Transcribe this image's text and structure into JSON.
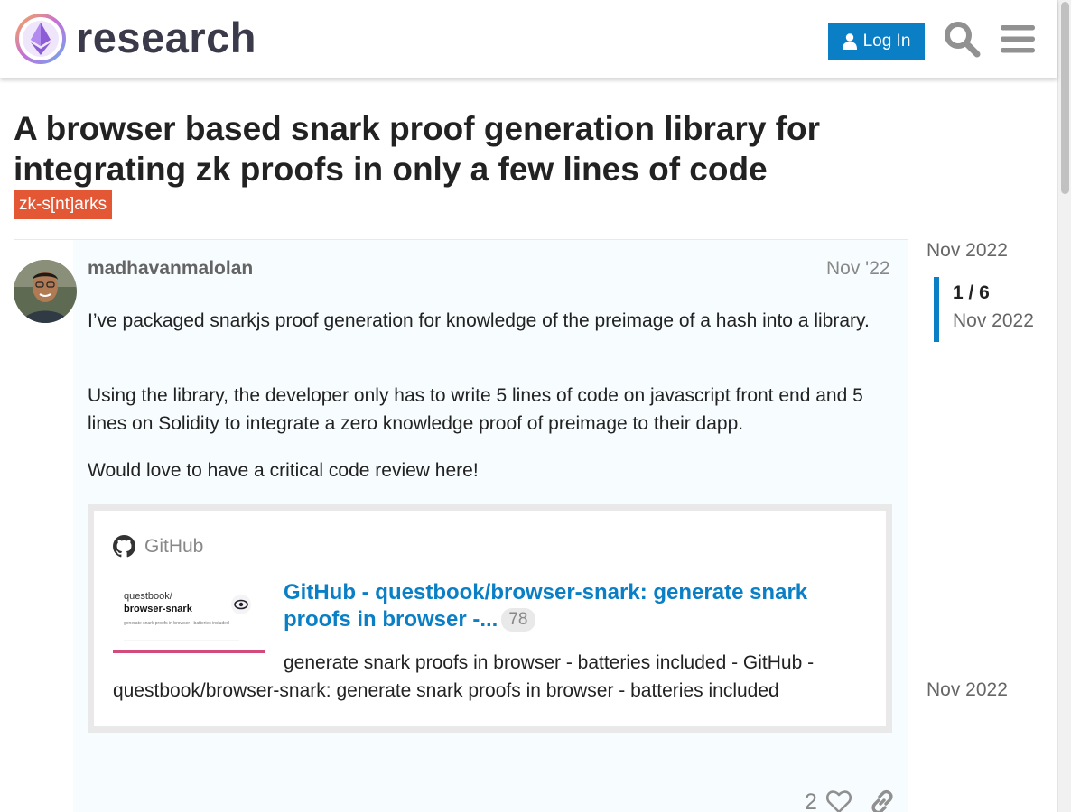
{
  "header": {
    "logo_text": "research",
    "login_label": "Log In",
    "search_icon": "search-icon",
    "menu_icon": "hamburger-menu-icon"
  },
  "topic": {
    "title": "A browser based snark proof generation library for integrating zk proofs in only a few lines of code",
    "tag": "zk-s[nt]arks"
  },
  "post": {
    "username": "madhavanmalolan",
    "date": "Nov '22",
    "paragraphs": [
      "I’ve packaged snarkjs proof generation for knowledge of the preimage of a hash into a library.",
      "Using the library, the developer only has to write 5 lines of code on javascript front end and 5 lines on Solidity to integrate a zero knowledge proof of preimage to their dapp.",
      "Would love to have a critical code review here!"
    ],
    "onebox": {
      "source": "GitHub",
      "title": "GitHub - questbook/browser-snark: generate snark proofs in browser -...",
      "click_count": "78",
      "description": "generate snark proofs in browser - batteries included - GitHub - questbook/browser-snark: generate snark proofs in browser - batteries included",
      "thumb": {
        "org": "questbook/",
        "repo": "browser-snark",
        "subtitle": "generate snark proofs in browser - batteries included"
      }
    },
    "like_count": "2"
  },
  "timeline": {
    "start": "Nov 2022",
    "position": "1 / 6",
    "current_date": "Nov 2022",
    "end": "Nov 2022"
  },
  "colors": {
    "accent": "#0a7fc5",
    "tag": "#e45735",
    "post_bg": "#f7fcfe"
  }
}
